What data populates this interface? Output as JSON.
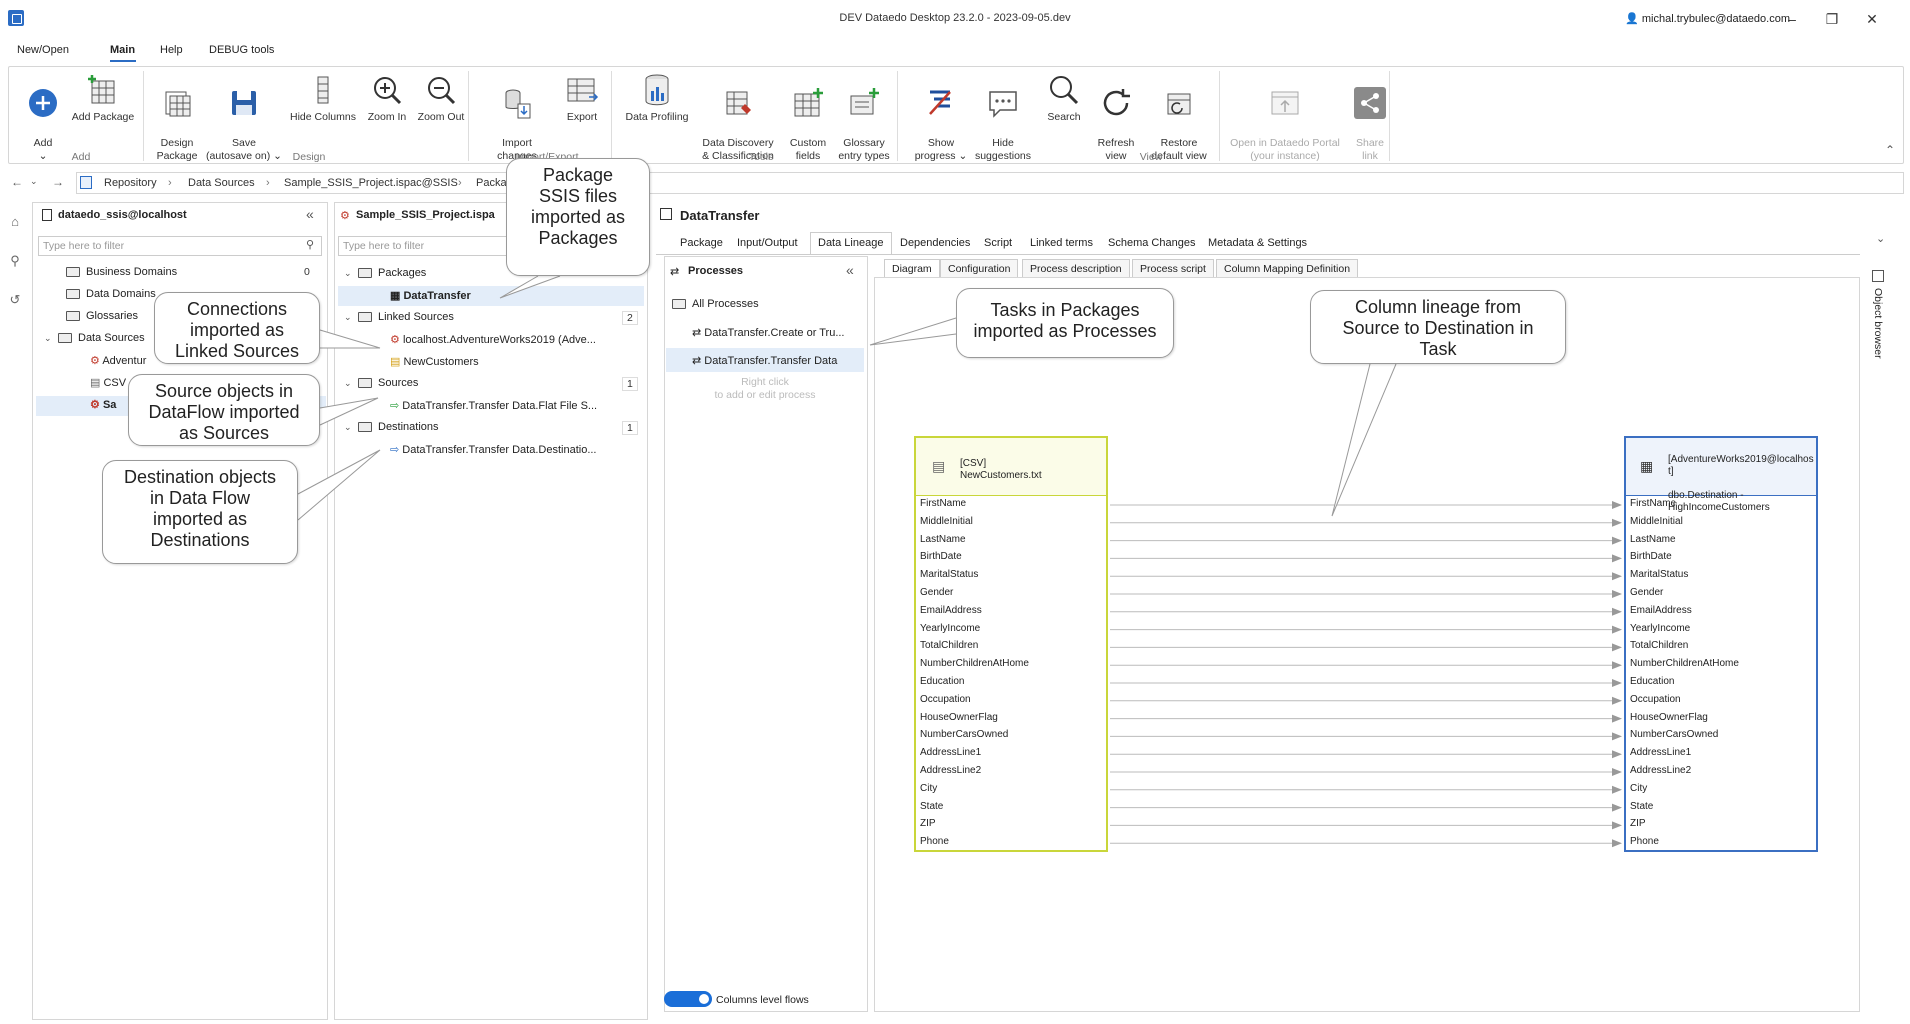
{
  "window": {
    "title": "DEV Dataedo Desktop 23.2.0 - 2023-09-05.dev",
    "user": "michal.trybulec@dataedo.com"
  },
  "menu_tabs": [
    "New/Open",
    "Main",
    "Help",
    "DEBUG tools"
  ],
  "ribbon": {
    "buttons": [
      {
        "label": "Add\n⌄"
      },
      {
        "label": "Add Package"
      },
      {
        "label": "Design\nPackage"
      },
      {
        "label": "Save\n(autosave on) ⌄"
      },
      {
        "label": "Hide Columns"
      },
      {
        "label": "Zoom In"
      },
      {
        "label": "Zoom Out"
      },
      {
        "label": "Import\nchanges"
      },
      {
        "label": "Export"
      },
      {
        "label": "Data Profiling"
      },
      {
        "label": "Data Discovery\n& Classification"
      },
      {
        "label": "Custom\nfields"
      },
      {
        "label": "Glossary\nentry types"
      },
      {
        "label": "Show\nprogress ⌄"
      },
      {
        "label": "Hide\nsuggestions"
      },
      {
        "label": "Search"
      },
      {
        "label": "Refresh\nview"
      },
      {
        "label": "Restore\ndefault view"
      },
      {
        "label": "Open in Dataedo Portal\n(your instance)"
      },
      {
        "label": "Share\nlink"
      }
    ],
    "groups": [
      "Add",
      "Design",
      "Import/Export",
      "Tools",
      "View"
    ]
  },
  "breadcrumb": [
    "Repository",
    "Data Sources",
    "Sample_SSIS_Project.ispac@SSIS",
    "Packa"
  ],
  "left_panel": {
    "title": "dataedo_ssis@localhost",
    "filter_placeholder": "Type here to filter",
    "items": [
      "Business Domains",
      "Data Domains",
      "Glossaries",
      "Data Sources",
      "Adventur",
      "CSV",
      "Sa"
    ],
    "business_domains_count": "0"
  },
  "middle_panel": {
    "title": "Sample_SSIS_Project.ispa",
    "filter_placeholder": "Type here to filter",
    "packages": "Packages",
    "package_item": "DataTransfer",
    "linked_sources": "Linked Sources",
    "linked_count": "2",
    "linked_1": "localhost.AdventureWorks2019 (Adve...",
    "linked_2": "NewCustomers",
    "sources": "Sources",
    "sources_count": "1",
    "source_1": "DataTransfer.Transfer Data.Flat File S...",
    "destinations": "Destinations",
    "dest_count": "1",
    "dest_1": "DataTransfer.Transfer Data.Destinatio..."
  },
  "callouts": {
    "packages": "Package\nSSIS files\nimported as\nPackages",
    "connections": "Connections\nimported as\nLinked Sources",
    "sources": "Source objects in\nDataFlow imported\nas Sources",
    "destinations": "Destination objects\nin Data Flow\nimported as\nDestinations",
    "tasks": "Tasks in Packages\nimported as Processes",
    "lineage": "Column lineage from\nSource to Destination in\nTask"
  },
  "object": {
    "title": "DataTransfer",
    "tabs": [
      "Package",
      "Input/Output",
      "Data Lineage",
      "Dependencies",
      "Script",
      "Linked terms",
      "Schema Changes",
      "Metadata & Settings"
    ],
    "processes_title": "Processes",
    "all_processes": "All Processes",
    "process_1": "DataTransfer.Create or Tru...",
    "process_2": "DataTransfer.Transfer Data",
    "hint": "Right click\nto add or edit process",
    "subtabs": [
      "Diagram",
      "Configuration",
      "Process description",
      "Process script",
      "Column Mapping Definition"
    ],
    "toggle_label": "Columns level flows",
    "object_browser": "Object browser"
  },
  "source_entity": {
    "type": "[CSV]",
    "name": "NewCustomers.txt"
  },
  "dest_entity": {
    "type": "[AdventureWorks2019@localhost]",
    "name": "dbo.Destination -\nHighIncomeCustomers"
  },
  "columns": [
    "FirstName",
    "MiddleInitial",
    "LastName",
    "BirthDate",
    "MaritalStatus",
    "Gender",
    "EmailAddress",
    "YearlyIncome",
    "TotalChildren",
    "NumberChildrenAtHome",
    "Education",
    "Occupation",
    "HouseOwnerFlag",
    "NumberCarsOwned",
    "AddressLine1",
    "AddressLine2",
    "City",
    "State",
    "ZIP",
    "Phone"
  ],
  "colors": {
    "accent": "#2b6cc4",
    "source_border": "#c9d63a",
    "source_fill": "#fbfce8",
    "dest_border": "#3b6fc2",
    "dest_fill": "#eef3fb"
  }
}
